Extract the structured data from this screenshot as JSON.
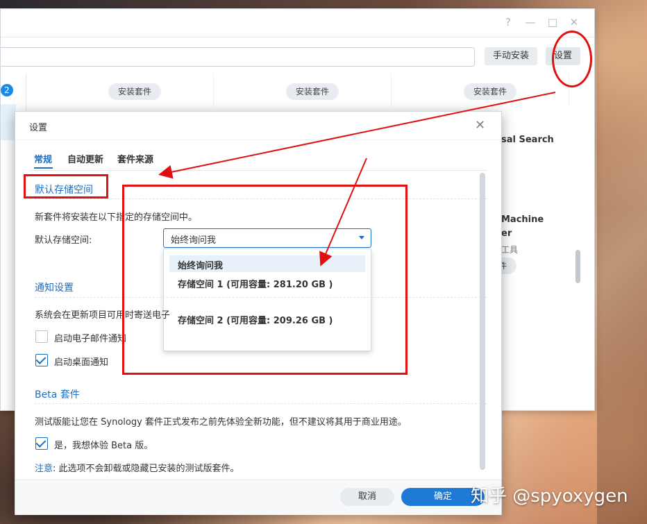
{
  "package_center": {
    "window_controls": [
      "?",
      "—",
      "□",
      "✕"
    ],
    "toolbar": {
      "manual_install_label": "手动安装",
      "settings_label": "设置"
    },
    "sidebar_badge": "2",
    "install_labels": [
      "安装套件",
      "安装套件",
      "安装套件"
    ],
    "right_cards": [
      {
        "title": "sal Search"
      },
      {
        "title": "Machine",
        "title2": "er",
        "subtitle": "工具",
        "button": "件"
      }
    ]
  },
  "dialog": {
    "title": "设置",
    "close": "✕",
    "tabs": [
      "常规",
      "自动更新",
      "套件来源"
    ],
    "active_tab": 0,
    "storage": {
      "heading": "默认存储空间",
      "description": "新套件将安装在以下指定的存储空间中。",
      "label": "默认存储空间:",
      "selected": "始终询问我",
      "options": [
        "始终询问我",
        "存储空间 1 (可用容量:  281.20 GB )",
        "存储空间 2 (可用容量:  209.26 GB )"
      ]
    },
    "notify": {
      "heading": "通知设置",
      "description": "系统会在更新项目可用时寄送电子",
      "email_label": "启动电子邮件通知",
      "email_checked": false,
      "desktop_label": "启动桌面通知",
      "desktop_checked": true
    },
    "beta": {
      "heading": "Beta 套件",
      "description": "测试版能让您在 Synology 套件正式发布之前先体验全新功能，但不建议将其用于商业用途。",
      "checkbox_label": "是，我想体验 Beta 版。",
      "checked": true,
      "note_prefix": "注意",
      "note": ": 此选项不会卸载或隐藏已安装的测试版套件。"
    },
    "footer": {
      "cancel_label": "取消",
      "ok_label": "确定"
    }
  },
  "watermark": "知乎 @spyoxygen",
  "colors": {
    "accent": "#1a6fc4",
    "annotation": "#e01010",
    "primary_button": "#1f7ad6"
  }
}
